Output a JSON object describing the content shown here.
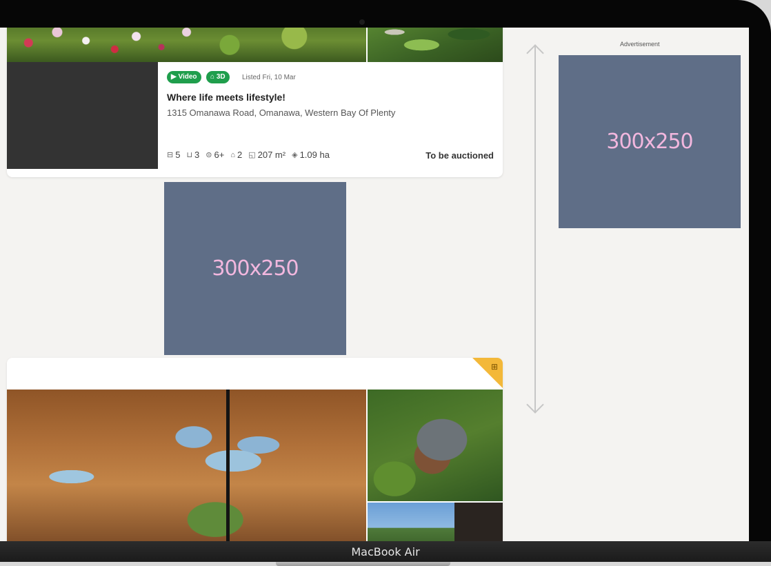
{
  "device": {
    "label": "MacBook Air"
  },
  "listing1": {
    "badges": {
      "video": "▶ Video",
      "threed": "⌂ 3D"
    },
    "listed": "Listed Fri, 10 Mar",
    "title": "Where life meets lifestyle!",
    "address": "1315 Omanawa Road, Omanawa, Western Bay Of Plenty",
    "features": {
      "bedrooms": "5",
      "bathrooms": "3",
      "parking": "6+",
      "garage": "2",
      "floor_area": "207 m²",
      "land_area": "1.09 ha"
    },
    "status": "To be auctioned"
  },
  "ads": {
    "label": "Advertisement",
    "sidebar": "300x250",
    "inline": "300x250"
  },
  "icons": {
    "bed": "bed-icon",
    "bath": "bath-icon",
    "car": "car-icon",
    "garage": "garage-icon",
    "floor": "floor-area-icon",
    "land": "land-area-icon",
    "corner": "plan-icon"
  },
  "colors": {
    "badge_green": "#1f9e4c",
    "ad_background": "#5f6e87",
    "ad_text": "#f2b7de",
    "corner_tag": "#f3b839"
  }
}
